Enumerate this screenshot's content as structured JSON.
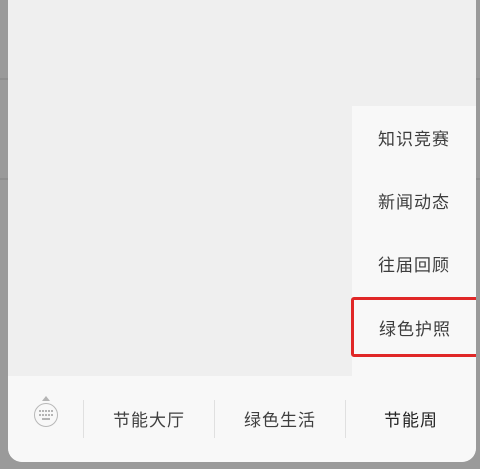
{
  "popup_menu": {
    "items": [
      {
        "label": "知识竞赛"
      },
      {
        "label": "新闻动态"
      },
      {
        "label": "往届回顾"
      },
      {
        "label": "绿色护照"
      }
    ],
    "highlight_color": "#e02727"
  },
  "bottom_bar": {
    "keyboard_icon": "keyboard-icon",
    "tabs": [
      {
        "label": "节能大厅"
      },
      {
        "label": "绿色生活"
      },
      {
        "label": "节能周"
      }
    ]
  }
}
